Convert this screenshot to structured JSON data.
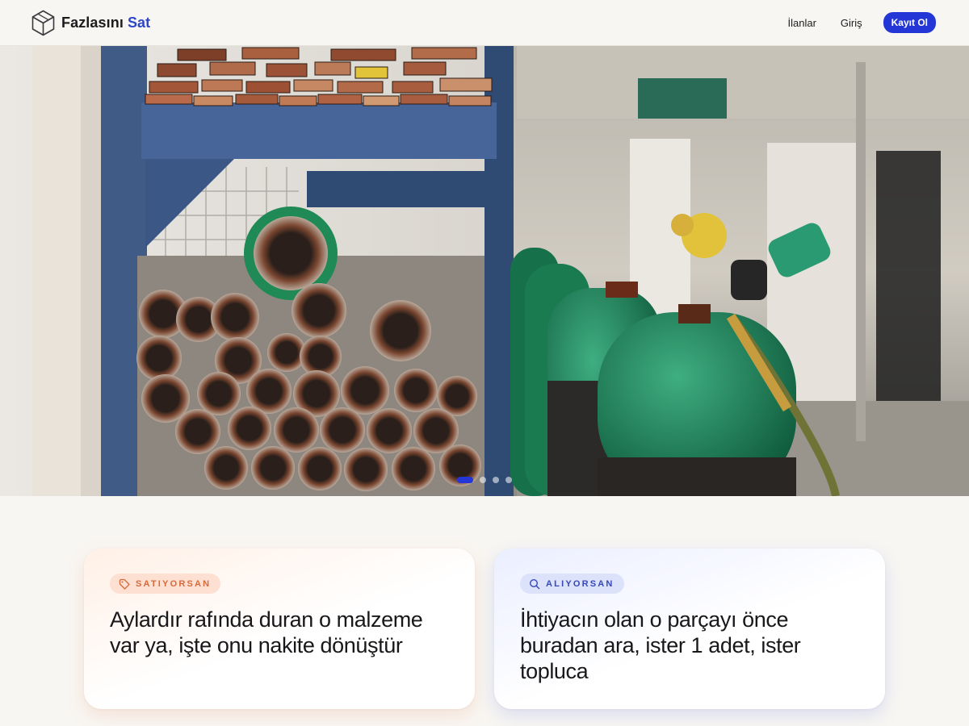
{
  "header": {
    "brand": {
      "name": "Fazlasını",
      "accent": "Sat",
      "icon": "cube-icon"
    },
    "nav": {
      "listings_label": "İlanlar",
      "login_label": "Giriş",
      "signup_label": "Kayıt Ol"
    }
  },
  "hero": {
    "slide_count": 4,
    "active_slide": 1
  },
  "cards": {
    "sell": {
      "badge": "SATIYORSAN",
      "icon": "tag-icon",
      "title": "Aylardır rafında duran o malzeme var ya, işte onu nakite dönüştür"
    },
    "buy": {
      "badge": "ALIYORSAN",
      "icon": "search-icon",
      "title": "İhtiyacın olan o parçayı önce buradan ara, ister 1 adet, ister topluca"
    }
  },
  "colors": {
    "background": "#f8f6f2",
    "accent": "#2f46c9",
    "cta": "#2536d6",
    "sell_badge": "#d66a3a",
    "buy_badge": "#3548b7"
  }
}
